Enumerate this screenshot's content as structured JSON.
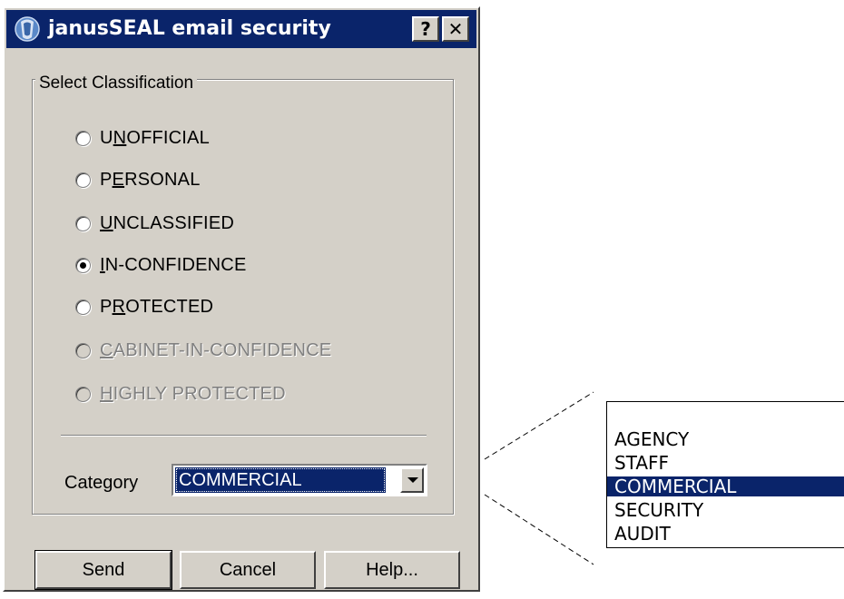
{
  "window": {
    "title": "janusSEAL email security",
    "help_button": "?",
    "close_button": "✕"
  },
  "classification": {
    "group_label": "Select Classification",
    "options": [
      {
        "pre": "U",
        "ul": "N",
        "post": "OFFICIAL",
        "checked": false,
        "enabled": true
      },
      {
        "pre": "P",
        "ul": "E",
        "post": "RSONAL",
        "checked": false,
        "enabled": true
      },
      {
        "pre": "",
        "ul": "U",
        "post": "NCLASSIFIED",
        "checked": false,
        "enabled": true
      },
      {
        "pre": "",
        "ul": "I",
        "post": "N-CONFIDENCE",
        "checked": true,
        "enabled": true
      },
      {
        "pre": "P",
        "ul": "R",
        "post": "OTECTED",
        "checked": false,
        "enabled": true
      },
      {
        "pre": "",
        "ul": "C",
        "post": "ABINET-IN-CONFIDENCE",
        "checked": false,
        "enabled": false
      },
      {
        "pre": "",
        "ul": "H",
        "post": "IGHLY PROTECTED",
        "checked": false,
        "enabled": false
      }
    ]
  },
  "category": {
    "label": "Category",
    "selected": "COMMERCIAL"
  },
  "buttons": {
    "send": "Send",
    "cancel": "Cancel",
    "help": "Help..."
  },
  "dropdown_list": {
    "items": [
      "AGENCY",
      "STAFF",
      "COMMERCIAL",
      "SECURITY",
      "AUDIT"
    ],
    "selected_index": 2
  },
  "colors": {
    "dialog_face": "#d4d0c8",
    "titlebar": "#0a246a",
    "selection": "#0a246a"
  }
}
